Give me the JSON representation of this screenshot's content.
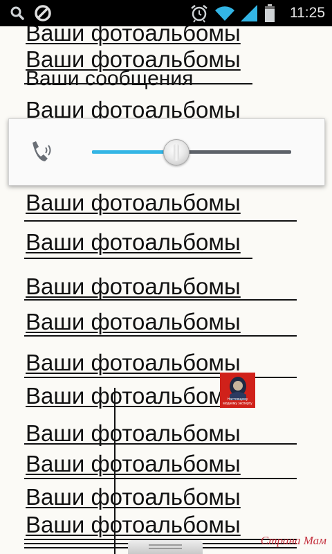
{
  "status_bar": {
    "time": "11:25",
    "icons": [
      "search-icon",
      "blocked-icon",
      "alarm-clock-icon",
      "wifi-icon",
      "signal-icon",
      "battery-icon"
    ]
  },
  "page": {
    "link_text": "Ваши фотоальбомы",
    "partial_text": "Ваши сообщения"
  },
  "volume_panel": {
    "icon": "phone-ring-icon",
    "level": 0.42,
    "accent": "#33b5e5"
  },
  "ad_badge": {
    "text": "Настоящему модному эксперту"
  },
  "watermark": {
    "text": "Страна Мам"
  }
}
